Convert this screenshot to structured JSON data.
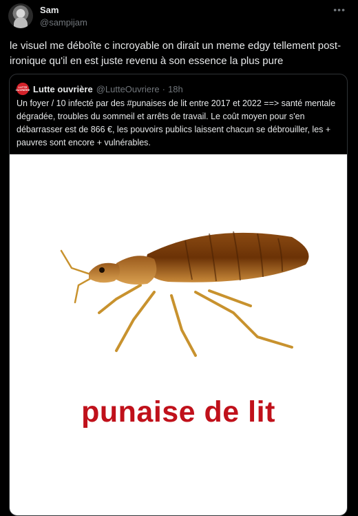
{
  "author": {
    "display_name": "Sam",
    "handle": "@sampijam"
  },
  "tweet_text": "le visuel me déboîte c incroyable on dirait un meme edgy tellement post-ironique qu'il en est juste revenu à son essence la plus pure",
  "quote": {
    "avatar_text": "LUTTE OUVRIÈRE",
    "display_name": "Lutte ouvrière",
    "handle": "@LutteOuvriere",
    "separator": "·",
    "time": "18h",
    "text": "Un foyer / 10 infecté par des #punaises de lit entre 2017 et 2022 ==> santé mentale dégradée, troubles du sommeil et arrêts de travail. Le coût moyen pour s'en débarrasser est de 866 €, les pouvoirs publics laissent chacun se débrouiller, les + pauvres sont encore + vulnérables.",
    "media_caption": "punaise de lit"
  },
  "icons": {
    "more": "more-horizontal-icon"
  },
  "colors": {
    "background": "#000000",
    "text": "#e7e9ea",
    "muted": "#71767b",
    "border": "#2f3336",
    "caption_red": "#c0111b",
    "brand_red": "#d4222a"
  }
}
